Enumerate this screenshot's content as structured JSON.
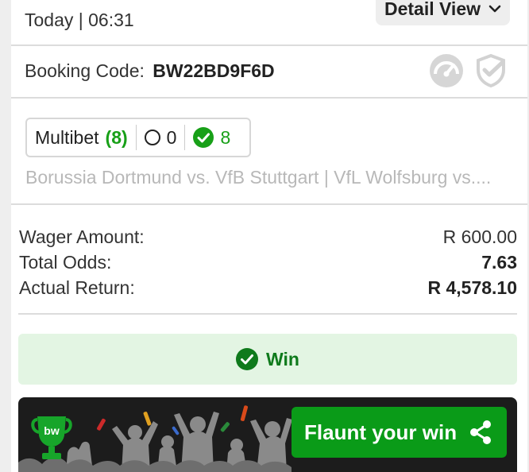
{
  "header": {
    "time_text": "Today | 06:31",
    "detail_view_label": "Detail View"
  },
  "booking": {
    "label": "Booking Code:",
    "code": "BW22BD9F6D"
  },
  "bet": {
    "type_label": "Multibet",
    "leg_count": "(8)",
    "open_count": "0",
    "won_count": "8",
    "matches_text": "Borussia Dortmund vs. VfB Stuttgart | VfL Wolfsburg vs...."
  },
  "summary": {
    "wager_label": "Wager Amount:",
    "wager_value": "R 600.00",
    "odds_label": "Total Odds:",
    "odds_value": "7.63",
    "return_label": "Actual Return:",
    "return_value": "R 4,578.10"
  },
  "result": {
    "status_label": "Win"
  },
  "banner": {
    "logo_text": "bw",
    "cta_label": "Flaunt your win"
  },
  "colors": {
    "brand_green": "#0a9b18",
    "win_background": "#e3f5e3",
    "win_text": "#0f7a1c",
    "banner_background": "#1c1c1c"
  },
  "icons": [
    "chevron-down-icon",
    "speedometer-icon",
    "shield-check-icon",
    "open-circle-icon",
    "check-circle-icon",
    "trophy-icon",
    "share-icon"
  ]
}
